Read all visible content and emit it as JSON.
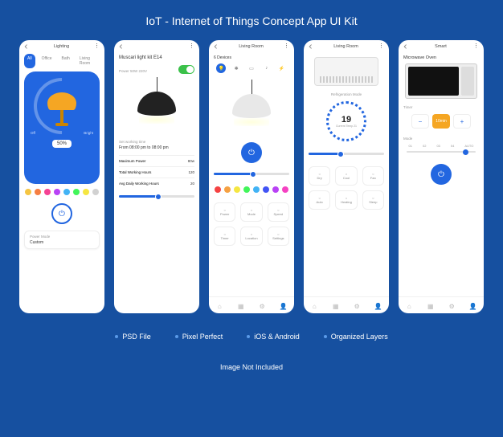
{
  "page_title": "IoT - Internet of Things Concept App UI Kit",
  "features": [
    "PSD File",
    "Pixel Perfect",
    "iOS & Android",
    "Organized Layers"
  ],
  "note": "Image Not Included",
  "screens": {
    "s1": {
      "title": "Lighting",
      "tabs": [
        "All",
        "Office",
        "Bath",
        "Living Room"
      ],
      "brightness_off": "Off",
      "brightness_bright": "Bright",
      "brightness_pct": "50%",
      "swatches": [
        "#f5c542",
        "#f57e42",
        "#f54293",
        "#b942f5",
        "#42b3f5",
        "#42f55a",
        "#f5e642",
        "#d1d1d1"
      ],
      "power_mode_label": "Power Mode",
      "power_mode_value": "Custom"
    },
    "s2": {
      "title": "Muscari light kit E14",
      "toggle_label": "Power 50W 220V",
      "schedule_label": "Set working time",
      "schedule_value": "From 08:00 pm to 08:00 pm",
      "stats": [
        {
          "k": "Maximum Power",
          "v": "80w"
        },
        {
          "k": "Total Working Hours",
          "v": "120"
        },
        {
          "k": "Avg Daily Working Hours",
          "v": "20"
        }
      ]
    },
    "s3": {
      "title": "Living Room",
      "subtitle": "6 Devices",
      "swatches": [
        "#f54242",
        "#f5a142",
        "#f5e642",
        "#42f55a",
        "#42b3f5",
        "#4254f5",
        "#b942f5",
        "#f542c2"
      ],
      "tiles": [
        "Power",
        "Mode",
        "Speed",
        "Timer",
        "Location",
        "Settings"
      ]
    },
    "s4": {
      "title": "Living Room",
      "mode_label": "Refrigeration Mode",
      "temp": "19",
      "temp_sub": "Current Temp 21",
      "tiles": [
        "Dry",
        "Cool",
        "Fan",
        "Auto",
        "Heating",
        "Sleep"
      ]
    },
    "s5": {
      "title": "Smart",
      "subtitle": "Microwave Oven",
      "timer_label": "Timer",
      "timer_val": "10min",
      "mode_label": "Mode",
      "modes": [
        "01",
        "02",
        "03",
        "04",
        "AUTO"
      ]
    }
  }
}
